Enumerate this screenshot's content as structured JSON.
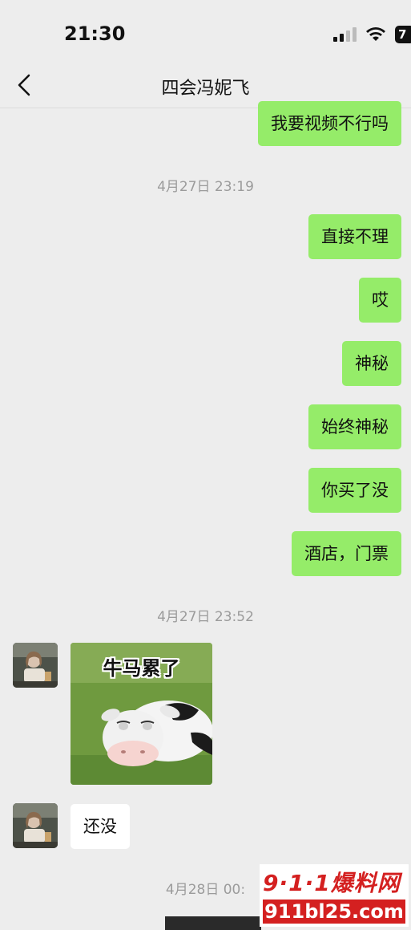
{
  "status_bar": {
    "time": "21:30",
    "battery": "7"
  },
  "header": {
    "title": "四会冯妮飞"
  },
  "messages": {
    "m1": "我要视频不行吗",
    "m2": "直接不理",
    "m3": "哎",
    "m4": "神秘",
    "m5": "始终神秘",
    "m6": "你买了没",
    "m7": "酒店，门票",
    "reply": "还没"
  },
  "timestamps": {
    "t1": "4月27日 23:19",
    "t2": "4月27日 23:52",
    "t3": "4月28日 00:"
  },
  "sticker": {
    "caption": "牛马累了"
  },
  "watermark": {
    "line1": "9·1·1爆料网",
    "line2": "911bl25.com"
  },
  "colors": {
    "outgoing_bubble": "#95ec69",
    "incoming_bubble": "#ffffff",
    "background": "#ededed"
  }
}
